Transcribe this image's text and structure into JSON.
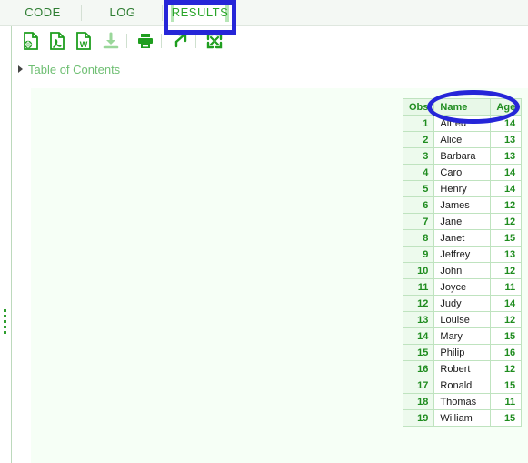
{
  "tabs": [
    {
      "id": "code",
      "label": "CODE",
      "active": false
    },
    {
      "id": "log",
      "label": "LOG",
      "active": false
    },
    {
      "id": "results",
      "label": "RESULTS",
      "active": true
    }
  ],
  "toolbar": {
    "buttons": [
      {
        "icon": "export-html-icon",
        "label": "Export as HTML"
      },
      {
        "icon": "export-pdf-icon",
        "label": "Export as PDF"
      },
      {
        "icon": "export-word-icon",
        "label": "Export as Word"
      },
      {
        "icon": "download-icon",
        "label": "Download"
      },
      {
        "icon": "print-icon",
        "label": "Print"
      },
      {
        "icon": "open-new-window-icon",
        "label": "Open in new window"
      },
      {
        "icon": "maximize-icon",
        "label": "Maximize view"
      }
    ]
  },
  "toc": {
    "label": "Table of Contents",
    "expanded": false,
    "arrow_icon": "triangle-right-icon"
  },
  "table": {
    "columns": [
      "Obs",
      "Name",
      "Age"
    ],
    "rows": [
      [
        "1",
        "Alfred",
        "14"
      ],
      [
        "2",
        "Alice",
        "13"
      ],
      [
        "3",
        "Barbara",
        "13"
      ],
      [
        "4",
        "Carol",
        "14"
      ],
      [
        "5",
        "Henry",
        "14"
      ],
      [
        "6",
        "James",
        "12"
      ],
      [
        "7",
        "Jane",
        "12"
      ],
      [
        "8",
        "Janet",
        "15"
      ],
      [
        "9",
        "Jeffrey",
        "13"
      ],
      [
        "10",
        "John",
        "12"
      ],
      [
        "11",
        "Joyce",
        "11"
      ],
      [
        "12",
        "Judy",
        "14"
      ],
      [
        "13",
        "Louise",
        "12"
      ],
      [
        "14",
        "Mary",
        "15"
      ],
      [
        "15",
        "Philip",
        "16"
      ],
      [
        "16",
        "Robert",
        "12"
      ],
      [
        "17",
        "Ronald",
        "15"
      ],
      [
        "18",
        "Thomas",
        "11"
      ],
      [
        "19",
        "William",
        "15"
      ]
    ]
  },
  "annotations": {
    "color": "#2626d8",
    "items": [
      {
        "name": "results-tab-highlight",
        "shape": "rectangle"
      },
      {
        "name": "table-header-highlight",
        "shape": "ellipse"
      }
    ]
  },
  "colors": {
    "accent_green": "#2e7d32",
    "table_header_bg": "#e8f8e8",
    "annotation_blue": "#2626d8",
    "pane_bg": "#f6fff6"
  }
}
